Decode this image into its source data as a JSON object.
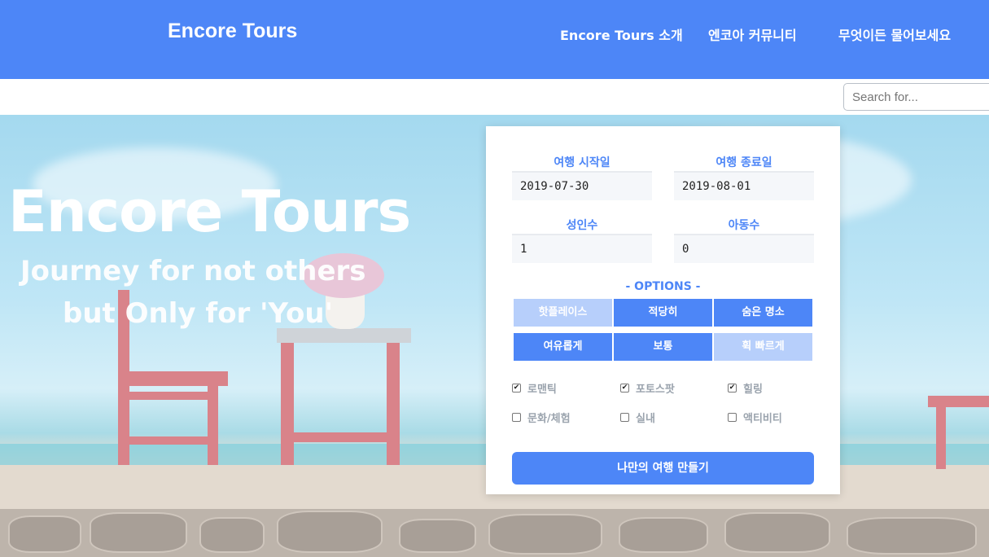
{
  "header": {
    "brand": "Encore Tours",
    "nav": [
      "Encore Tours 소개",
      "엔코아 커뮤니티",
      "무엇이든 물어보세요"
    ]
  },
  "search": {
    "placeholder": "Search for..."
  },
  "hero": {
    "title": "Encore Tours",
    "subtitle_line1": "Journey for not others",
    "subtitle_line2": "but Only for 'You'"
  },
  "form": {
    "start_label": "여행 시작일",
    "start_value": "2019-07-30",
    "end_label": "여행 종료일",
    "end_value": "2019-08-01",
    "adults_label": "성인수",
    "adults_value": "1",
    "kids_label": "아동수",
    "kids_value": "0",
    "options_title": "- OPTIONS -",
    "options_row1": [
      {
        "label": "핫플레이스",
        "selected": false
      },
      {
        "label": "적당히",
        "selected": true
      },
      {
        "label": "숨은 명소",
        "selected": true
      }
    ],
    "options_row2": [
      {
        "label": "여유롭게",
        "selected": true
      },
      {
        "label": "보통",
        "selected": true
      },
      {
        "label": "휙 빠르게",
        "selected": false
      }
    ],
    "themes": [
      {
        "label": "로맨틱",
        "checked": true
      },
      {
        "label": "포토스팟",
        "checked": true
      },
      {
        "label": "힐링",
        "checked": true
      },
      {
        "label": "문화/체험",
        "checked": false
      },
      {
        "label": "실내",
        "checked": false
      },
      {
        "label": "액티비티",
        "checked": false
      }
    ],
    "submit_label": "나만의 여행 만들기"
  },
  "colors": {
    "primary": "#4d86f7",
    "primary_light": "#b7cffb"
  }
}
